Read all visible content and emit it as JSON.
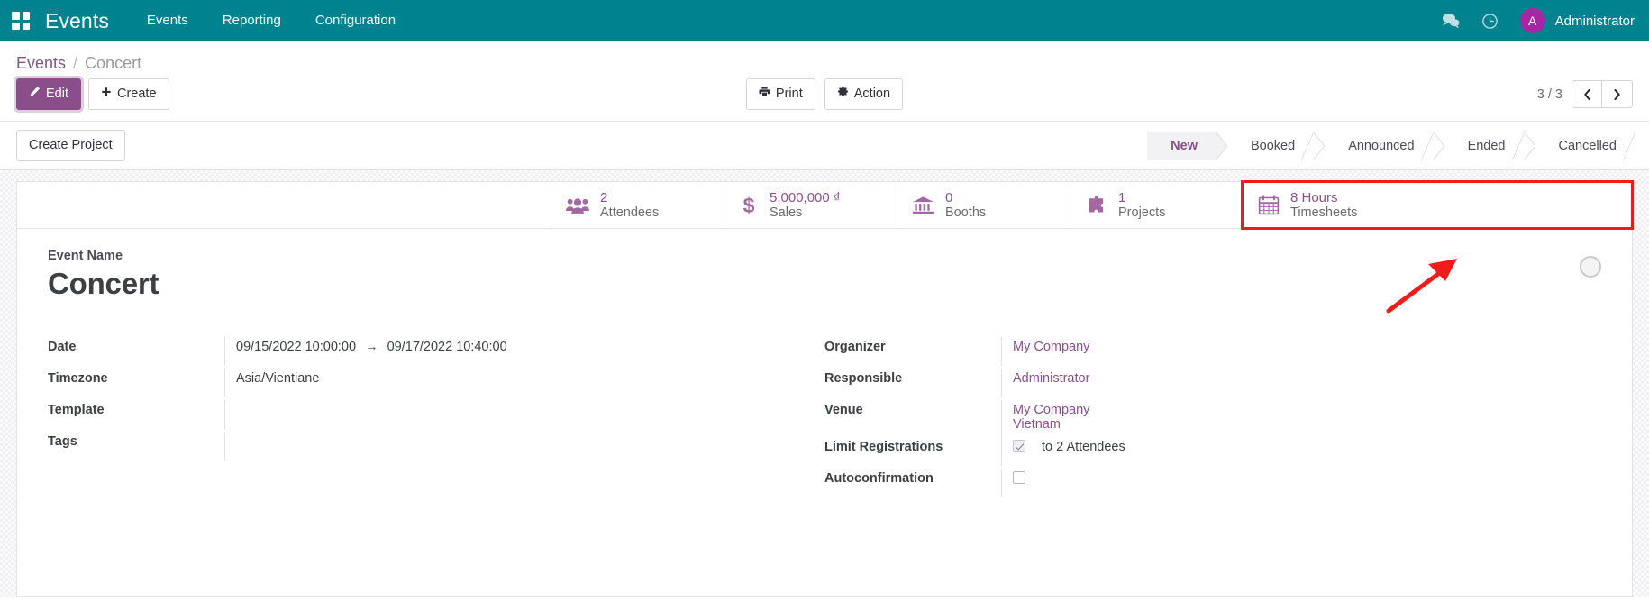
{
  "navbar": {
    "apps_icon": "apps-grid-icon",
    "brand": "Events",
    "menu": [
      {
        "label": "Events"
      },
      {
        "label": "Reporting"
      },
      {
        "label": "Configuration"
      }
    ],
    "messages_icon": "messages-icon",
    "activity_icon": "clock-activity-icon",
    "avatar_initial": "A",
    "user_name": "Administrator"
  },
  "breadcrumb": {
    "root": "Events",
    "separator": "/",
    "current": "Concert"
  },
  "controls": {
    "edit_label": "Edit",
    "create_label": "Create",
    "print_label": "Print",
    "action_label": "Action",
    "pager_count": "3 / 3",
    "prev_icon": "chevron-left-icon",
    "next_icon": "chevron-right-icon"
  },
  "sheet_bar": {
    "create_project_label": "Create Project",
    "statuses": [
      {
        "label": "New",
        "active": true
      },
      {
        "label": "Booked",
        "active": false
      },
      {
        "label": "Announced",
        "active": false
      },
      {
        "label": "Ended",
        "active": false
      },
      {
        "label": "Cancelled",
        "active": false
      }
    ]
  },
  "smart_buttons": [
    {
      "icon": "attendees-people-icon",
      "value": "2",
      "label": "Attendees",
      "highlighted": false
    },
    {
      "icon": "dollar-sales-icon",
      "value": "5,000,000 ₫",
      "label": "Sales",
      "highlighted": false
    },
    {
      "icon": "booth-bank-icon",
      "value": "0",
      "label": "Booths",
      "highlighted": false
    },
    {
      "icon": "project-puzzle-icon",
      "value": "1",
      "label": "Projects",
      "highlighted": false
    },
    {
      "icon": "timesheets-calendar-icon",
      "value": "8 Hours",
      "label": "Timesheets",
      "highlighted": true
    }
  ],
  "form": {
    "title_label": "Event Name",
    "title_value": "Concert",
    "image_placeholder": "event-cover-image-placeholder",
    "left_fields": [
      {
        "label": "Date",
        "value": "09/15/2022 10:00:00",
        "value2": "09/17/2022 10:40:00",
        "separator": "→"
      },
      {
        "label": "Timezone",
        "value": "Asia/Vientiane"
      },
      {
        "label": "Template",
        "value": ""
      },
      {
        "label": "Tags",
        "value": ""
      }
    ],
    "right_fields": [
      {
        "label": "Organizer",
        "value": "My Company",
        "link": true
      },
      {
        "label": "Responsible",
        "value": "Administrator",
        "link": true
      },
      {
        "label": "Venue",
        "value": "My Company",
        "value2": "Vietnam",
        "link": true
      },
      {
        "label": "Limit Registrations",
        "checkbox": true,
        "checked": true,
        "value": "to 2 Attendees"
      },
      {
        "label": "Autoconfirmation",
        "checkbox": true,
        "checked": false,
        "value": ""
      }
    ]
  },
  "annotations": {
    "highlight_color": "#f01c1c",
    "arrow_name": "red-pointer-arrow"
  },
  "colors": {
    "brand_teal": "#00838f",
    "accent_purple": "#8a4f8a",
    "annotation_red": "#f01c1c"
  }
}
